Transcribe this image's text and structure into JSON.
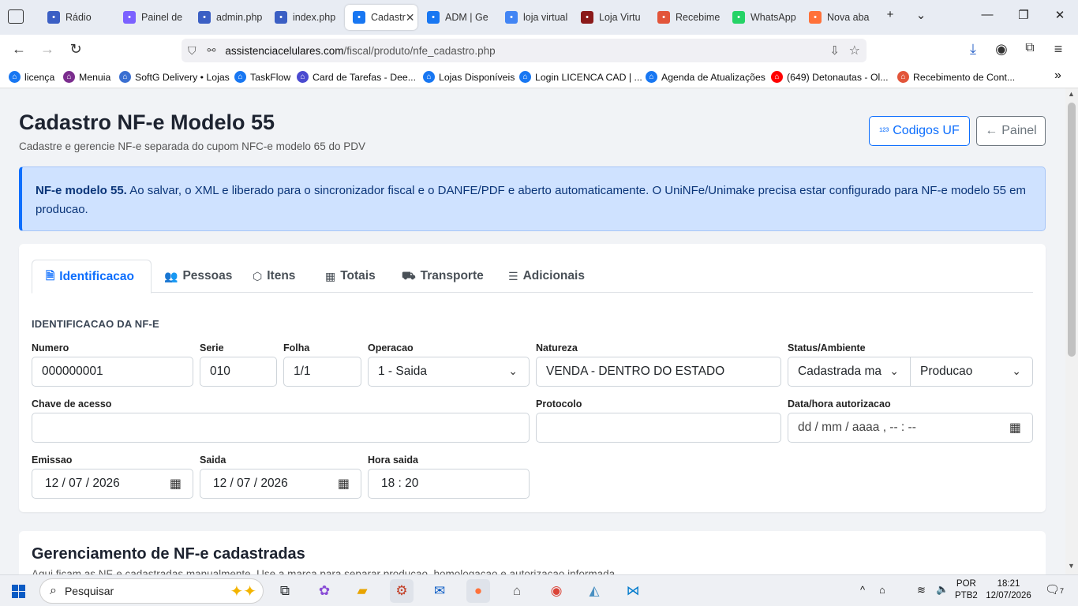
{
  "browser": {
    "tabs": [
      {
        "label": "Rádio",
        "icon": "radio-icon",
        "color": "#3b5fc4"
      },
      {
        "label": "Painel de",
        "icon": "panel-icon",
        "color": "#7b61ff"
      },
      {
        "label": "admin.php",
        "icon": "globe-icon",
        "color": "#3b5fc4"
      },
      {
        "label": "index.php",
        "icon": "globe-icon",
        "color": "#3b5fc4"
      },
      {
        "label": "Cadastr",
        "icon": "home-icon",
        "color": "#1877f2",
        "active": true
      },
      {
        "label": "ADM | Ge",
        "icon": "home-icon",
        "color": "#1877f2"
      },
      {
        "label": "loja virtual",
        "icon": "google-icon",
        "color": "#4285f4"
      },
      {
        "label": "Loja Virtu",
        "icon": "store-icon",
        "color": "#8b1a1a"
      },
      {
        "label": "Recebime",
        "icon": "receipt-icon",
        "color": "#e2553a"
      },
      {
        "label": "WhatsApp",
        "icon": "whatsapp-icon",
        "color": "#25d366"
      },
      {
        "label": "Nova aba",
        "icon": "firefox-icon",
        "color": "#ff7139"
      }
    ],
    "url_domain": "assistenciacelulares.com",
    "url_path": "/fiscal/produto/nfe_cadastro.php",
    "bookmarks": [
      {
        "label": "licença",
        "color": "#1877f2"
      },
      {
        "label": "Menuia",
        "color": "#7b2d8e"
      },
      {
        "label": "SoftG Delivery • Lojas",
        "color": "#3a6fd1"
      },
      {
        "label": "TaskFlow",
        "color": "#1877f2"
      },
      {
        "label": "Card de Tarefas - Dee...",
        "color": "#4a4ad0"
      },
      {
        "label": "Lojas Disponíveis",
        "color": "#1877f2"
      },
      {
        "label": "Login LICENCA CAD | ...",
        "color": "#1877f2"
      },
      {
        "label": "Agenda de Atualizações",
        "color": "#1877f2"
      },
      {
        "label": "(649) Detonautas - Ol...",
        "color": "#ff0000"
      },
      {
        "label": "Recebimento de Cont...",
        "color": "#e2553a"
      }
    ]
  },
  "page": {
    "title": "Cadastro NF-e Modelo 55",
    "subtitle": "Cadastre e gerencie NF-e separada do cupom NFC-e modelo 65 do PDV",
    "btn_codigos": "Codigos UF",
    "btn_codigos_icon": "¹²³",
    "btn_painel": "Painel",
    "btn_painel_icon": "←",
    "alert_strong": "NF-e modelo 55.",
    "alert_text": " Ao salvar, o XML e liberado para o sincronizador fiscal e o DANFE/PDF e aberto automaticamente. O UniNFe/Unimake precisa estar configurado para NF-e modelo 55 em producao.",
    "tabs": [
      "Identificacao",
      "Pessoas",
      "Itens",
      "Totais",
      "Transporte",
      "Adicionais"
    ],
    "section_title": "IDENTIFICACAO DA NF-E",
    "form": {
      "numero_label": "Numero",
      "numero_value": "000000001",
      "serie_label": "Serie",
      "serie_value": "010",
      "folha_label": "Folha",
      "folha_value": "1/1",
      "operacao_label": "Operacao",
      "operacao_value": "1 - Saida",
      "natureza_label": "Natureza",
      "natureza_value": "VENDA - DENTRO DO ESTADO",
      "status_label": "Status/Ambiente",
      "status_value": "Cadastrada ma",
      "ambiente_value": "Producao",
      "chave_label": "Chave de acesso",
      "chave_value": "",
      "protocolo_label": "Protocolo",
      "protocolo_value": "",
      "autorizacao_label": "Data/hora autorizacao",
      "autorizacao_placeholder": "dd / mm / aaaa ,  -- : --",
      "emissao_label": "Emissao",
      "emissao_value": "12 / 07 / 2026",
      "saida_label": "Saida",
      "saida_value": "12 / 07 / 2026",
      "hora_label": "Hora saida",
      "hora_value": "18 : 20"
    },
    "manage_title": "Gerenciamento de NF-e cadastradas",
    "manage_text": "Aqui ficam as NF-e cadastradas manualmente. Use a marca para separar producao, homologacao e autorizacao informada."
  },
  "taskbar": {
    "search_placeholder": "Pesquisar",
    "lang_top": "POR",
    "lang_bottom": "PTB2",
    "time": "18:21",
    "date": "12/07/2026",
    "notif_count": "7"
  }
}
